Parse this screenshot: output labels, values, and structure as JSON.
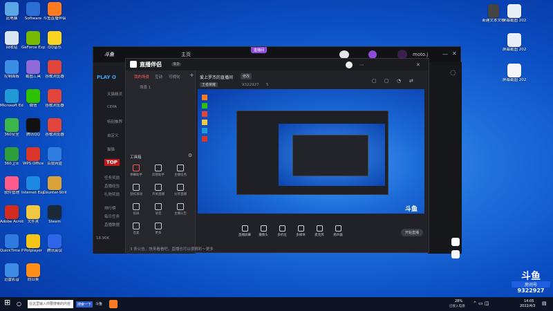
{
  "desktop": {
    "left_icons": [
      {
        "label": "此电脑",
        "color": "#5aa7e8"
      },
      {
        "label": "Software",
        "color": "#2b6fd6"
      },
      {
        "label": "斗鱼直播伴侣",
        "color": "#ff7a21"
      },
      {
        "label": "回收站",
        "color": "#d9e6f2"
      },
      {
        "label": "GeForce Experience",
        "color": "#76b900"
      },
      {
        "label": "QQ音乐",
        "color": "#f9d423"
      },
      {
        "label": "控制面板",
        "color": "#3a8ee6"
      },
      {
        "label": "截图工具",
        "color": "#8e6ad8"
      },
      {
        "label": "谷歌浏览器",
        "color": "#e2453c"
      },
      {
        "label": "Microsoft Edge",
        "color": "#1f9ad6"
      },
      {
        "label": "微信",
        "color": "#2dc100"
      },
      {
        "label": "谷歌浏览器",
        "color": "#e2453c"
      },
      {
        "label": "360安全",
        "color": "#3cb54a"
      },
      {
        "label": "腾讯QQ",
        "color": "#111111"
      },
      {
        "label": "谷歌浏览器",
        "color": "#e2453c"
      },
      {
        "label": "360卫士",
        "color": "#2e9e3b"
      },
      {
        "label": "WPS Office",
        "color": "#d9352b"
      },
      {
        "label": "百度网盘",
        "color": "#2f7de1"
      },
      {
        "label": "软件管理",
        "color": "#ff5b8a"
      },
      {
        "label": "Internet Explorer",
        "color": "#1e88e5"
      },
      {
        "label": "Counter-Strike",
        "color": "#d9a23a"
      },
      {
        "label": "Adobe Acrobat",
        "color": "#d42b1f"
      },
      {
        "label": "文件夹",
        "color": "#f2c744"
      },
      {
        "label": "Steam",
        "color": "#1b2838"
      },
      {
        "label": "QuickTime Player",
        "color": "#2d7be0"
      },
      {
        "label": "Potplayer",
        "color": "#f5c518"
      },
      {
        "label": "腾讯会议",
        "color": "#2f66e8"
      },
      {
        "label": "迅雷影音",
        "color": "#3c8ce7"
      },
      {
        "label": "向日葵",
        "color": "#ff8d1a"
      }
    ],
    "right_icons": [
      {
        "label": "新建文本文档"
      },
      {
        "label": "屏幕截图 2022..."
      },
      {
        "label": "屏幕截图 2022..."
      },
      {
        "label": "屏幕截图 2022..."
      }
    ]
  },
  "outer_window": {
    "logo": "斗鱼",
    "nav": "主页",
    "badge": "直播间",
    "user": "moto.j",
    "side_items": [
      "PLAY O",
      "天猫精灵",
      "CEPA",
      "特别推荐",
      "自定义",
      "猫猫"
    ],
    "promo_lines": [
      "任务奖励",
      "直播经验",
      "礼物奖励",
      "排行榜",
      "每日任务",
      "直播数据"
    ],
    "footer": "18.90K"
  },
  "app": {
    "title": "直播伴侣",
    "ver": "9.0",
    "tabs": [
      "我的场景",
      "互动",
      "可视化"
    ],
    "scene": "场景 1",
    "stream_title": "爱上罗杰的直播间",
    "stream_btn": "修改",
    "category": "王者荣耀",
    "room_id": "9322927",
    "followers": "5",
    "tools_header": "工具箱",
    "tools": [
      "弹幕助手",
      "房管助手",
      "主播任务",
      "鼠标滚动",
      "开关直播",
      "分享直播",
      "投屏",
      "语音",
      "主播公告",
      "连麦",
      "更多"
    ],
    "notice": "3 条公告，快来看看吧，直播也可以很精彩～更多",
    "bottom_buttons": [
      "直播屏幕",
      "摄像头",
      "多机位",
      "多媒体",
      "麦克风",
      "扬声器"
    ],
    "start_btn": "开始直播"
  },
  "watermark": {
    "logo": "斗鱼",
    "sub": "房间号",
    "room": "9322927"
  },
  "taskbar": {
    "search": "在这里输入你要搜索的内容",
    "pinned": [
      "搜索一下",
      "斗鱼"
    ],
    "battery": "28%",
    "battery_sub": "已接入电源",
    "time": "14:05",
    "date": "2022/4/3"
  }
}
